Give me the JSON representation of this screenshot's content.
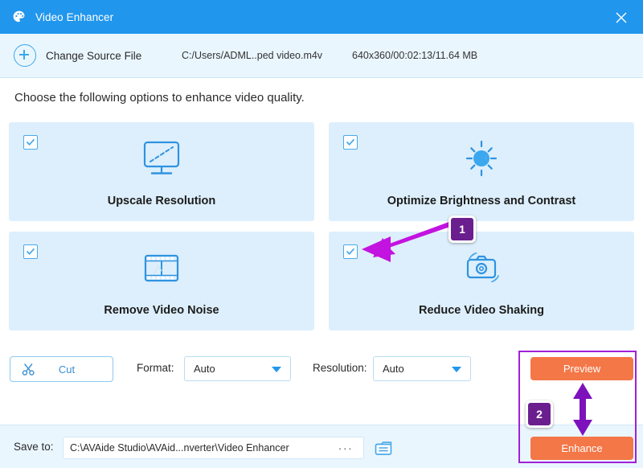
{
  "window": {
    "title": "Video Enhancer",
    "icon": "palette-icon",
    "close_label": "✕"
  },
  "source_bar": {
    "add_icon": "plus-circle-icon",
    "change_source_label": "Change Source File",
    "path": "C:/Users/ADML..ped video.m4v",
    "meta": "640x360/00:02:13/11.64 MB"
  },
  "instruction": "Choose the following options to enhance video quality.",
  "options": [
    {
      "label": "Upscale Resolution",
      "icon": "monitor-upscale-icon",
      "checked": true
    },
    {
      "label": "Optimize Brightness and Contrast",
      "icon": "sun-brightness-icon",
      "checked": true
    },
    {
      "label": "Remove Video Noise",
      "icon": "film-strip-icon",
      "checked": true
    },
    {
      "label": "Reduce Video Shaking",
      "icon": "camera-shake-icon",
      "checked": true
    }
  ],
  "controls": {
    "cut_label": "Cut",
    "cut_icon": "scissors-icon",
    "format_label": "Format:",
    "format_value": "Auto",
    "resolution_label": "Resolution:",
    "resolution_value": "Auto",
    "caret_icon": "chevron-down-icon"
  },
  "actions": {
    "preview_label": "Preview",
    "enhance_label": "Enhance"
  },
  "save_bar": {
    "save_to_label": "Save to:",
    "path": "C:\\AVAide Studio\\AVAid...nverter\\Video Enhancer",
    "browse_label": "···",
    "folder_icon": "open-folder-icon"
  },
  "annotations": {
    "badge_1": "1",
    "badge_2": "2"
  },
  "colors": {
    "titlebar": "#2196ed",
    "card": "#ddeffc",
    "accent_blue": "#3ba7ee",
    "action_orange": "#f47748",
    "annotation_purple": "#a020d8",
    "badge_purple": "#6b1f8f"
  }
}
